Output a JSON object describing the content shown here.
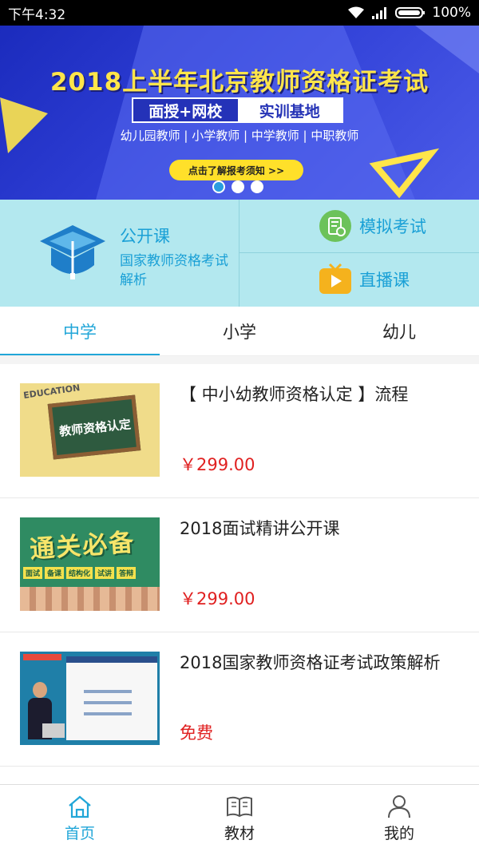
{
  "status_bar": {
    "time": "下午4:32",
    "battery": "100%"
  },
  "banner": {
    "title": "2018上半年北京教师资格证考试",
    "tag_left": "面授+网校",
    "tag_right": "实训基地",
    "subtitle": "幼儿园教师 | 小学教师 | 中学教师 | 中职教师",
    "button": "点击了解报考须知 >>",
    "active_index": 0,
    "slide_count": 3
  },
  "quick_menu": {
    "open_course": {
      "title": "公开课",
      "desc": "国家教师资格考试解析"
    },
    "mock_exam": "模拟考试",
    "live": "直播课"
  },
  "tabs": [
    {
      "label": "中学",
      "active": true
    },
    {
      "label": "小学",
      "active": false
    },
    {
      "label": "幼儿",
      "active": false
    }
  ],
  "courses": [
    {
      "title": "【 中小幼教师资格认定 】流程",
      "price": "￥299.00",
      "thumb_text": "教师资格认定",
      "thumb_sub": "EDUCATION"
    },
    {
      "title": "2018面试精讲公开课",
      "price": "￥299.00",
      "thumb_text": "通关必备",
      "thumb_pills": [
        "面试",
        "备课",
        "结构化",
        "试讲",
        "答辩"
      ]
    },
    {
      "title": "2018国家教师资格证考试政策解析",
      "price": "免费"
    }
  ],
  "bottom_nav": [
    {
      "label": "首页",
      "icon": "home-icon",
      "active": true
    },
    {
      "label": "教材",
      "icon": "book-icon",
      "active": false
    },
    {
      "label": "我的",
      "icon": "user-icon",
      "active": false
    }
  ],
  "colors": {
    "accent": "#21a6d8",
    "price": "#e02020",
    "quick_bg": "#b3e8ef"
  }
}
